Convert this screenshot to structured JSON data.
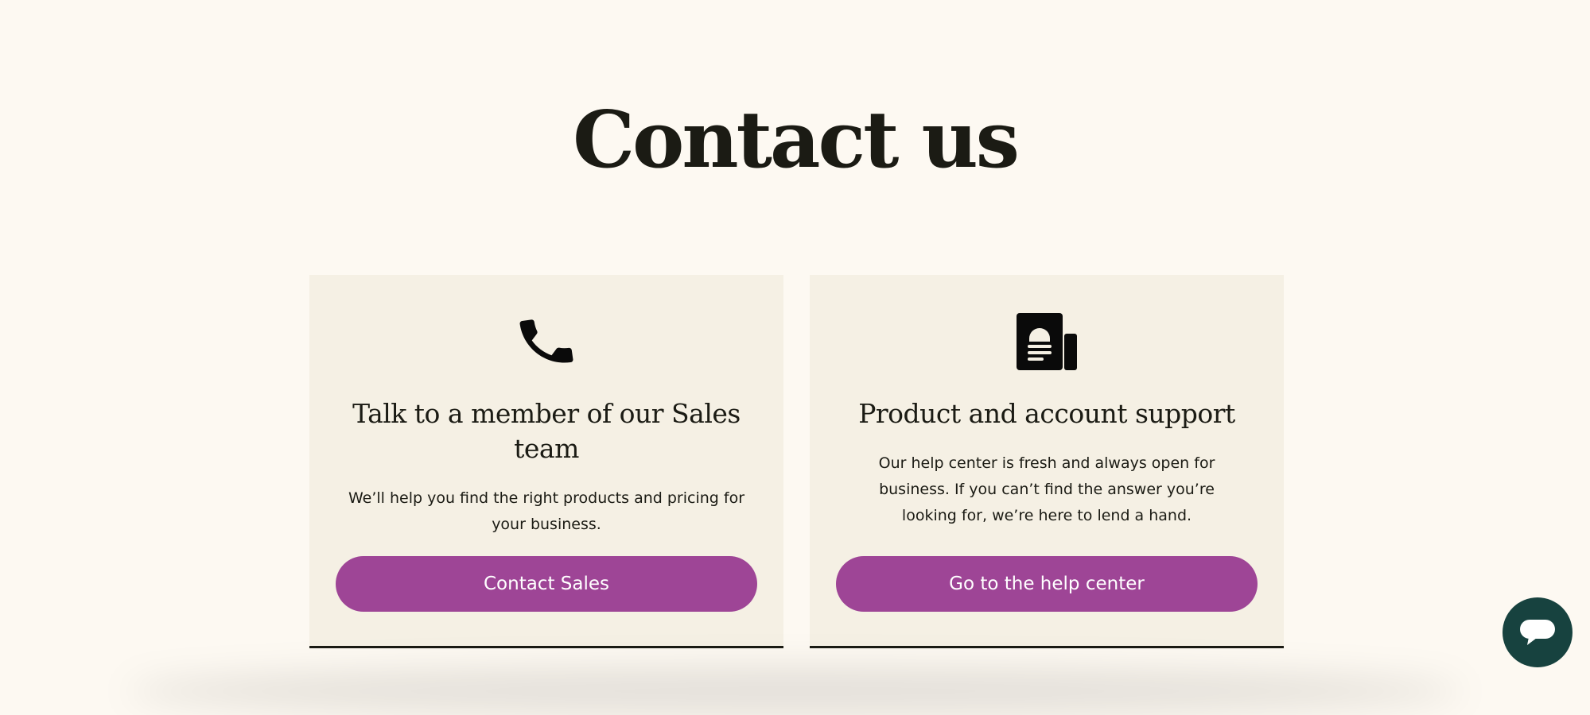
{
  "page": {
    "title": "Contact us"
  },
  "cards": [
    {
      "icon": "phone-icon",
      "title": "Talk to a member of our Sales team",
      "description": "We’ll help you find the right products and pricing for your business.",
      "button_label": "Contact Sales"
    },
    {
      "icon": "help-document-icon",
      "title": "Product and account support",
      "description": "Our help center is fresh and always open for business. If you can’t find the answer you’re looking for, we’re here to lend a hand.",
      "button_label": "Go to the help center"
    }
  ],
  "chat_widget": {
    "icon": "chat-bubble-icon"
  },
  "colors": {
    "background": "#fdf9f2",
    "card_background": "#f5f0e4",
    "button": "#9e4596",
    "chat_button": "#17423f",
    "text": "#1b1b14"
  }
}
